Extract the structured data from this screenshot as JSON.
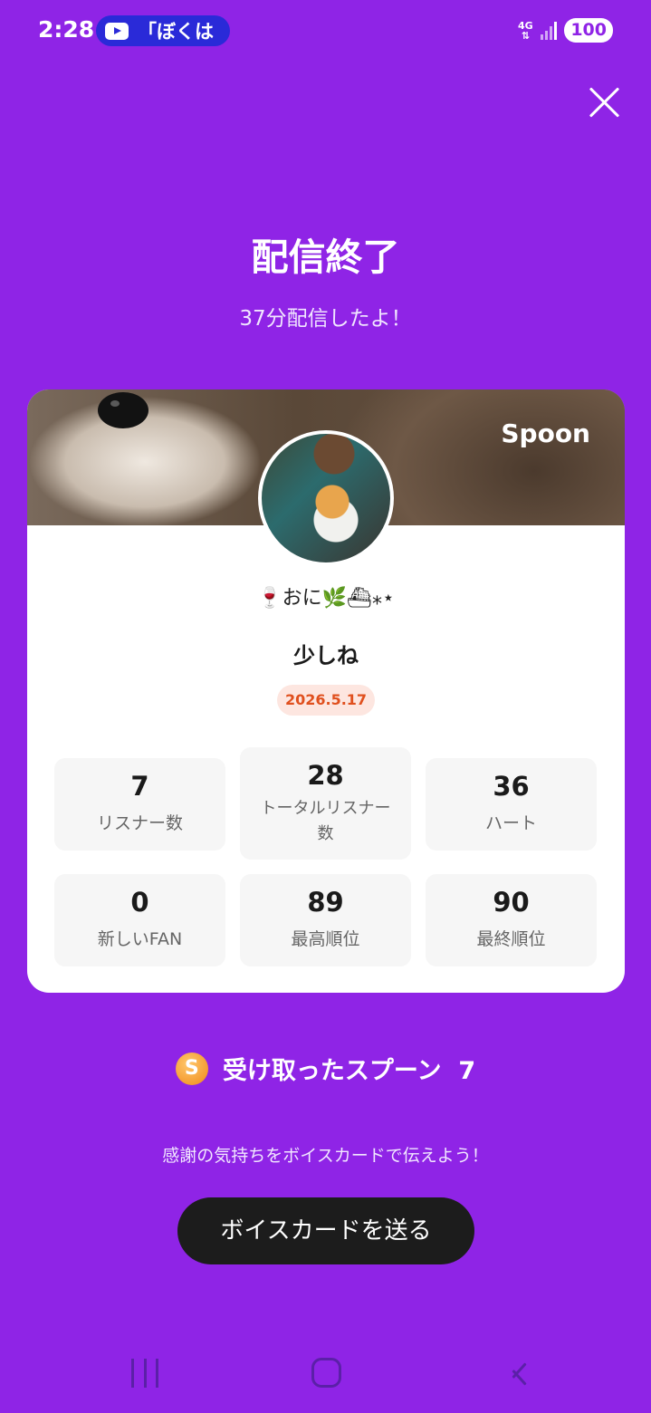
{
  "status_bar": {
    "time": "2:28",
    "media_text": "「ぼくは",
    "network": "4G",
    "battery": "100"
  },
  "header": {
    "title": "配信終了",
    "subtitle": "37分配信したよ！"
  },
  "card": {
    "brand": "Spoon",
    "nickname": "🍷おに🌿⛴⁎⋆",
    "show_title": "少しね",
    "date": "2026.5.17",
    "stats": [
      {
        "value": "7",
        "label": "リスナー数"
      },
      {
        "value": "28",
        "label": "トータルリスナー数"
      },
      {
        "value": "36",
        "label": "ハート"
      },
      {
        "value": "0",
        "label": "新しいFAN"
      },
      {
        "value": "89",
        "label": "最高順位"
      },
      {
        "value": "90",
        "label": "最終順位"
      }
    ]
  },
  "spoons": {
    "icon_letter": "S",
    "label": "受け取ったスプーン",
    "count": "7"
  },
  "thanks_message": "感謝の気持ちをボイスカードで伝えよう！",
  "voice_card_button": "ボイスカードを送る",
  "colors": {
    "background": "#8f24e6",
    "date_badge_bg": "#fde6e0",
    "date_badge_text": "#e0501e",
    "button_bg": "#1c1c1c"
  }
}
